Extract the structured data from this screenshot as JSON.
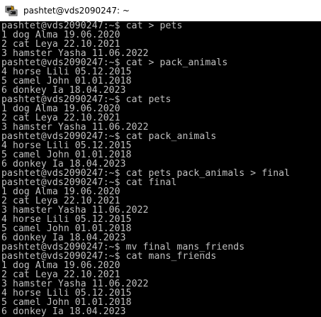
{
  "window": {
    "title": "pashtet@vds2090247: ~",
    "icon": "putty-icon",
    "colors": {
      "terminal_bg": "#000000",
      "terminal_fg": "#c0c0c0",
      "titlebar_bg": "#ffffff"
    }
  },
  "terminal": {
    "lines": [
      "pashtet@vds2090247:~$ cat > pets",
      "1 dog Alma 19.06.2020",
      "2 cat Leya 22.10.2021",
      "3 hamster Yasha 11.06.2022",
      "pashtet@vds2090247:~$ cat > pack_animals",
      "4 horse Lili 05.12.2015",
      "5 camel John 01.01.2018",
      "6 donkey Ia 18.04.2023",
      "pashtet@vds2090247:~$ cat pets",
      "1 dog Alma 19.06.2020",
      "2 cat Leya 22.10.2021",
      "3 hamster Yasha 11.06.2022",
      "pashtet@vds2090247:~$ cat pack_animals",
      "4 horse Lili 05.12.2015",
      "5 camel John 01.01.2018",
      "6 donkey Ia 18.04.2023",
      "pashtet@vds2090247:~$ cat pets pack_animals > final",
      "pashtet@vds2090247:~$ cat final",
      "1 dog Alma 19.06.2020",
      "2 cat Leya 22.10.2021",
      "3 hamster Yasha 11.06.2022",
      "4 horse Lili 05.12.2015",
      "5 camel John 01.01.2018",
      "6 donkey Ia 18.04.2023",
      "pashtet@vds2090247:~$ mv final mans_friends",
      "pashtet@vds2090247:~$ cat mans_friends",
      "1 dog Alma 19.06.2020",
      "2 cat Leya 22.10.2021",
      "3 hamster Yasha 11.06.2022",
      "4 horse Lili 05.12.2015",
      "5 camel John 01.01.2018",
      "6 donkey Ia 18.04.2023"
    ]
  }
}
